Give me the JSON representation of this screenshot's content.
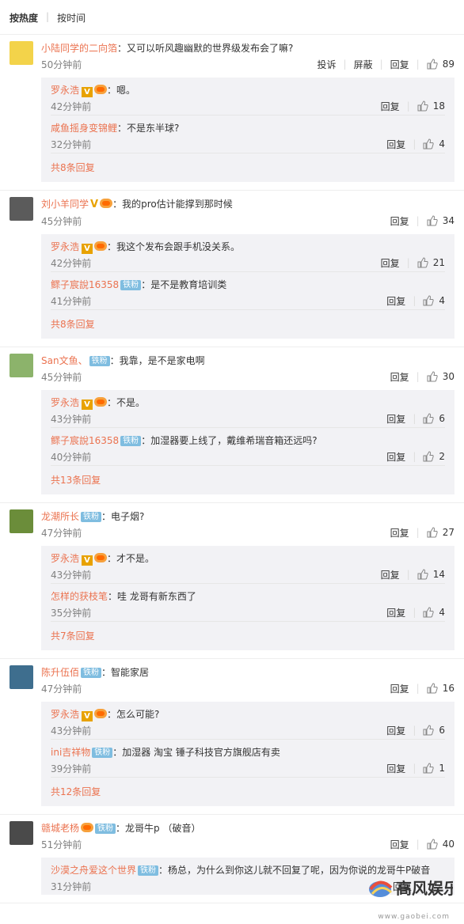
{
  "sort": {
    "hot": "按热度",
    "time": "按时间"
  },
  "colors": {
    "accent": "#eb7350",
    "badge": "#7fbde0"
  },
  "actions": {
    "report": "投诉",
    "block": "屏蔽",
    "reply": "回复"
  },
  "comments": [
    {
      "user": "小陆同学的二向箔",
      "text": "又可以听风趣幽默的世界级发布会了嘛?",
      "time": "50分钟前",
      "likes": "89",
      "replies": [
        {
          "user": "罗永浩",
          "text": "嗯。",
          "time": "42分钟前",
          "likes": "18"
        },
        {
          "user": "咸鱼摇身变锦鲤",
          "text": "不是东半球?",
          "time": "32分钟前",
          "likes": "4"
        }
      ],
      "more": "共8条回复"
    },
    {
      "user": "刘小羊同学",
      "text": "我的pro估计能撑到那时候",
      "time": "45分钟前",
      "likes": "34",
      "replies": [
        {
          "user": "罗永浩",
          "text": "我这个发布会跟手机没关系。",
          "time": "42分钟前",
          "likes": "21"
        },
        {
          "user": "鳏子宸說16358",
          "badge": "铁粉",
          "text": "是不是教育培训类",
          "time": "41分钟前",
          "likes": "4"
        }
      ],
      "more": "共8条回复"
    },
    {
      "user": "San文鱼、",
      "badge": "铁粉",
      "text": "我靠，是不是家电啊",
      "time": "45分钟前",
      "likes": "30",
      "replies": [
        {
          "user": "罗永浩",
          "text": "不是。",
          "time": "43分钟前",
          "likes": "6"
        },
        {
          "user": "鳏子宸說16358",
          "badge": "铁粉",
          "text": "加湿器要上线了，戴维希瑞音箱还远吗?",
          "time": "40分钟前",
          "likes": "2"
        }
      ],
      "more": "共13条回复"
    },
    {
      "user": "龙潮所长",
      "badge": "铁粉",
      "text": "电子烟?",
      "time": "47分钟前",
      "likes": "27",
      "replies": [
        {
          "user": "罗永浩",
          "text": "才不是。",
          "time": "43分钟前",
          "likes": "14"
        },
        {
          "user": "怎样的获枝笔",
          "text": "哇 龙哥有新东西了",
          "time": "35分钟前",
          "likes": "4"
        }
      ],
      "more": "共7条回复"
    },
    {
      "user": "陈升伍佰",
      "badge": "铁粉",
      "text": "智能家居",
      "time": "47分钟前",
      "likes": "16",
      "replies": [
        {
          "user": "罗永浩",
          "text": "怎么可能?",
          "time": "43分钟前",
          "likes": "6"
        },
        {
          "user": "ini吉祥物",
          "badge": "铁粉",
          "text": "加湿器 淘宝 锤子科技官方旗舰店有卖",
          "time": "39分钟前",
          "likes": "1"
        }
      ],
      "more": "共12条回复"
    },
    {
      "user": "赣城老杨",
      "badge": "铁粉",
      "text": "龙哥牛p （破音）",
      "time": "51分钟前",
      "likes": "40",
      "replies": [
        {
          "user": "沙漠之舟爱这个世界",
          "badge": "铁粉",
          "text": "杨总，为什么到你这儿就不回复了呢，因为你说的龙哥牛P破音",
          "time": "31分钟前",
          "likes": ""
        }
      ],
      "more": ""
    }
  ],
  "watermark": {
    "brand": "高风娱乐",
    "url": "www.gaobei.com"
  }
}
